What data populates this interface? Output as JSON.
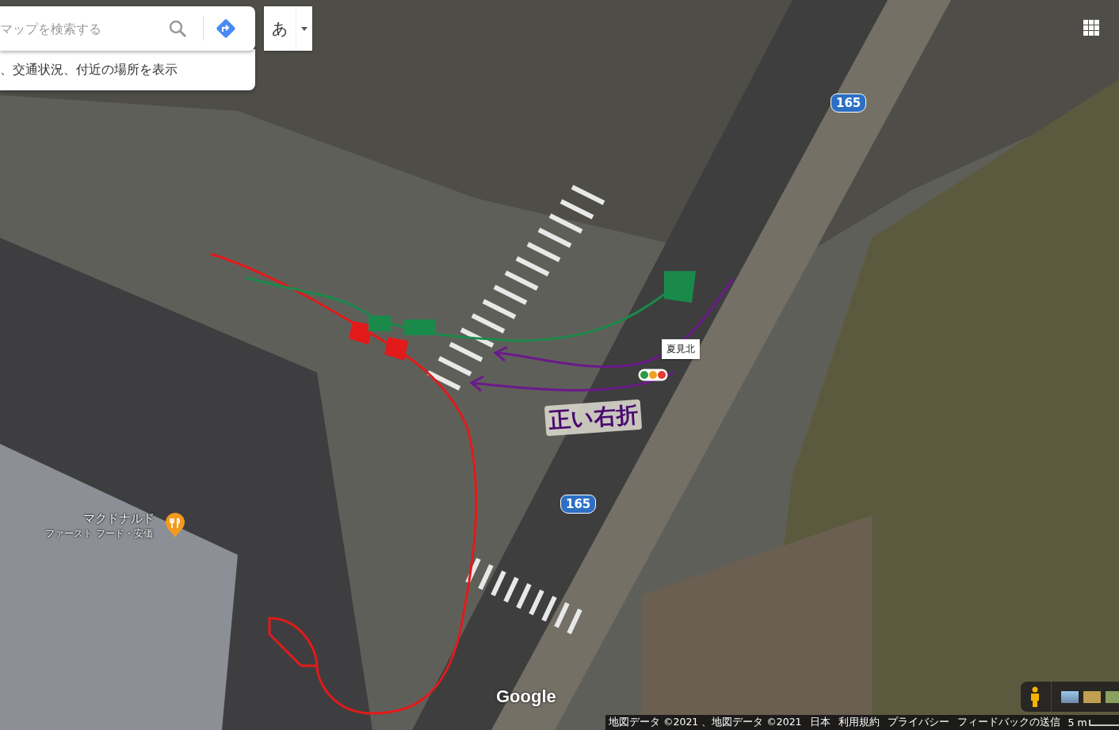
{
  "search": {
    "placeholder": "マップを検索する",
    "suggestion": "、交通状況、付近の場所を表示"
  },
  "ime_button": {
    "label": "あ"
  },
  "map": {
    "labels": [
      {
        "kind": "route",
        "text": "165"
      },
      {
        "kind": "route",
        "text": "165"
      },
      {
        "kind": "place",
        "text": "夏見北"
      },
      {
        "kind": "poi",
        "text": "マクドナルド",
        "subtitle": "ファースト フード・安価"
      }
    ],
    "annotation": "正い右折",
    "logo": "Google"
  },
  "footer": {
    "items": [
      "地図データ ©2021 、地図データ ©2021",
      "日本",
      "利用規約",
      "プライバシー",
      "フィードバックの送信"
    ],
    "scale": "5 m"
  }
}
